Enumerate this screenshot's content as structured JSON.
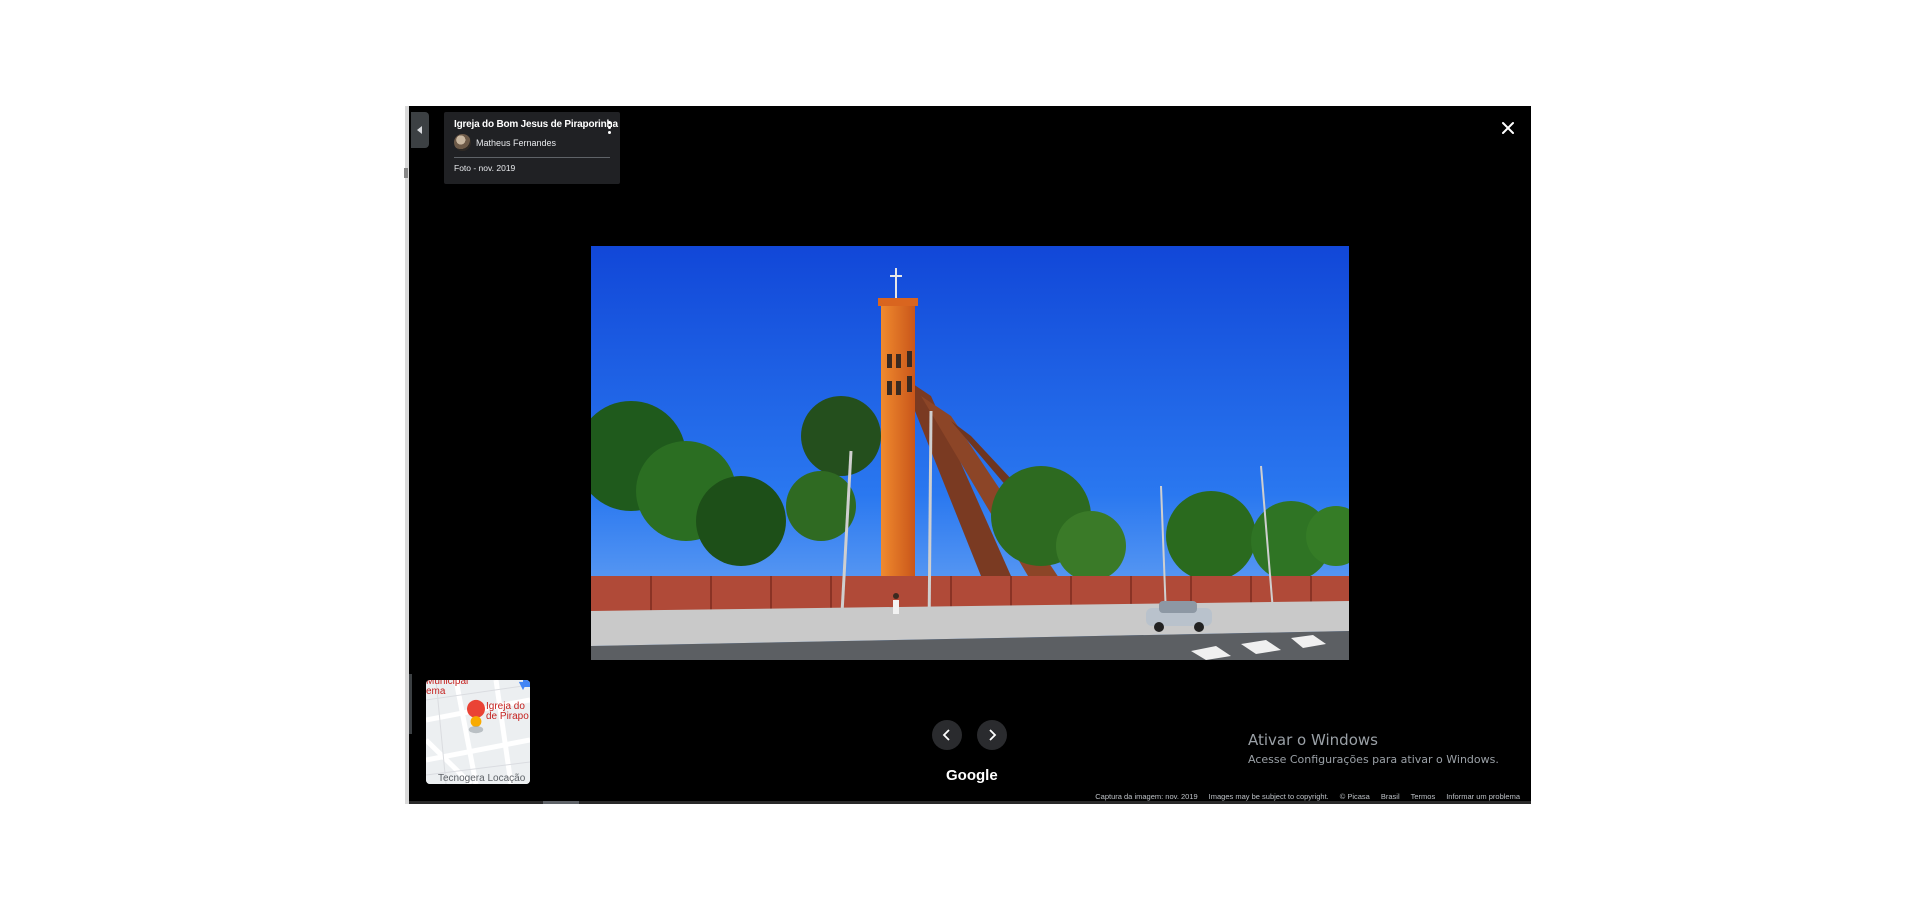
{
  "info_card": {
    "title": "Igreja do Bom Jesus de Piraporinha",
    "author": "Matheus Fernandes",
    "photo_date": "Foto - nov. 2019"
  },
  "minimap": {
    "label_left": "Municipal\nema",
    "label_place": "Igreja do\nde Pirapo",
    "label_bottom": "Tecnogera Locação"
  },
  "brand": {
    "logo_text": "Google"
  },
  "watermark": {
    "title": "Ativar o Windows",
    "subtitle": "Acesse Configurações para ativar o Windows."
  },
  "footer": {
    "capture_date": "Captura da imagem: nov. 2019",
    "copyright": "Images may be subject to copyright.",
    "picasa": "© Picasa",
    "country": "Brasil",
    "terms": "Termos",
    "report": "Informar um problema"
  },
  "colors": {
    "viewer_bg": "#000000",
    "card_bg": "#202124",
    "sky": "#1a5fe0",
    "tower": "#e0701f",
    "pin": "#ea4335"
  },
  "icons": [
    "chevron-left-icon",
    "more-vert-icon",
    "close-icon",
    "prev-arrow-icon",
    "next-arrow-icon",
    "map-pin-icon",
    "compass-icon"
  ]
}
